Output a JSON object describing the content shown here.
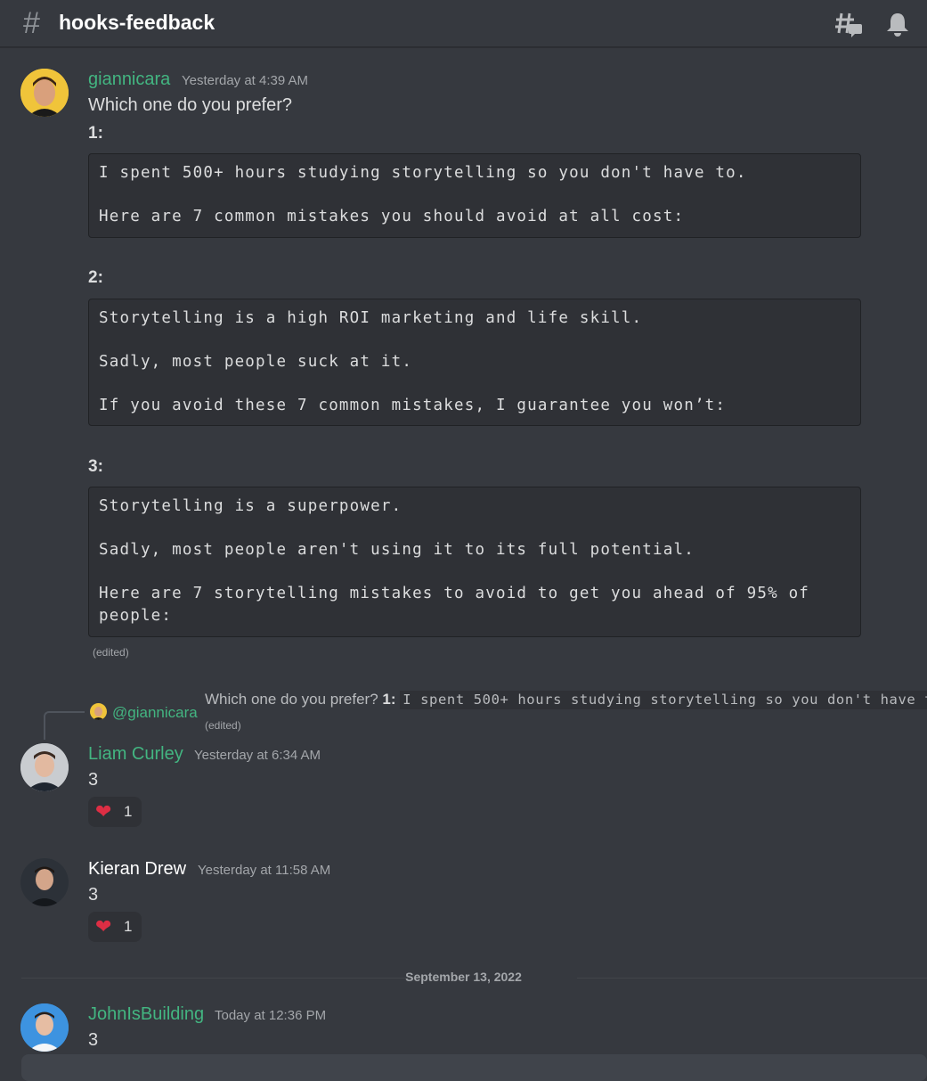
{
  "header": {
    "channel_icon": "hashtag-icon",
    "channel_name": "hooks-feedback",
    "threads_icon": "threads-icon",
    "notification_icon": "bell-icon"
  },
  "colors": {
    "username_green": "#43b581",
    "background": "#36393f",
    "code_background": "#2f3136",
    "heart": "#dd2e44"
  },
  "messages": [
    {
      "author": "giannicara",
      "timestamp": "Yesterday at 4:39 AM",
      "text": "Which one do you prefer?",
      "options": [
        {
          "label": "1:",
          "code": "I spent 500+ hours studying storytelling so you don't have to.\n\nHere are 7 common mistakes you should avoid at all cost:"
        },
        {
          "label": "2:",
          "code": "Storytelling is a high ROI marketing and life skill.\n\nSadly, most people suck at it.\n\nIf you avoid these 7 common mistakes, I guarantee you won’t:"
        },
        {
          "label": "3:",
          "code": "Storytelling is a superpower.\n\nSadly, most people aren't using it to its full potential.\n\nHere are 7 storytelling mistakes to avoid to get you ahead of 95% of\npeople:"
        }
      ],
      "edited": "(edited)"
    },
    {
      "reply": {
        "mention": "@giannicara",
        "preview_text": "Which one do you prefer?",
        "preview_label": "1:",
        "preview_code": "I spent 500+ hours studying storytelling so you don't have t",
        "edited": "(edited)"
      },
      "author": "Liam Curley",
      "timestamp": "Yesterday at 6:34 AM",
      "text": "3",
      "reaction": {
        "emoji": "heart-icon",
        "count": "1"
      }
    },
    {
      "author": "Kieran Drew",
      "timestamp": "Yesterday at 11:58 AM",
      "text": "3",
      "reaction": {
        "emoji": "heart-icon",
        "count": "1"
      }
    },
    {
      "author": "JohnIsBuilding",
      "timestamp": "Today at 12:36 PM",
      "text": "3"
    }
  ],
  "date_divider": "September 13, 2022"
}
